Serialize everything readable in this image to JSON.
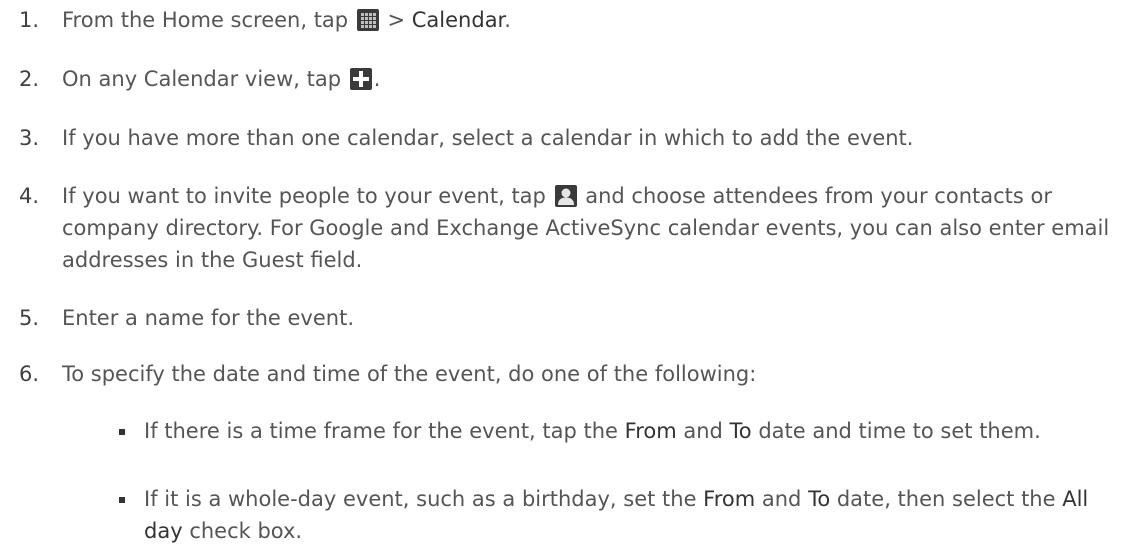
{
  "steps": [
    {
      "num": "1.",
      "pre": "From the Home screen, tap ",
      "icon": "apps-grid-icon",
      "mid": " > ",
      "bold": "Calendar",
      "post": "."
    },
    {
      "num": "2.",
      "pre": "On any Calendar view, tap ",
      "icon": "add-plus-icon",
      "post": "."
    },
    {
      "num": "3.",
      "text": "If you have more than one calendar, select a calendar in which to add the event."
    },
    {
      "num": "4.",
      "pre": "If you want to invite people to your event, tap ",
      "icon": "contact-person-icon",
      "post": " and choose attendees from your contacts or company directory. For Google and Exchange ActiveSync calendar events, you can also enter email addresses in the Guest field."
    },
    {
      "num": "5.",
      "text": "Enter a name for the event."
    },
    {
      "num": "6.",
      "text": "To specify the date and time of the event, do one of the following:"
    }
  ],
  "bullets": [
    {
      "t1": "If there is a time frame for the event, tap the ",
      "b1": "From",
      "t2": " and ",
      "b2": "To",
      "t3": " date and time to set them."
    },
    {
      "t1": "If it is a whole-day event, such as a birthday, set the ",
      "b1": "From",
      "t2": " and ",
      "b2": "To",
      "t3": " date, then select the ",
      "b3": "All day",
      "t4": " check box."
    }
  ],
  "colors": {
    "text": "#555555",
    "bold": "#333333",
    "icon_bg": "#3a3a3a"
  }
}
